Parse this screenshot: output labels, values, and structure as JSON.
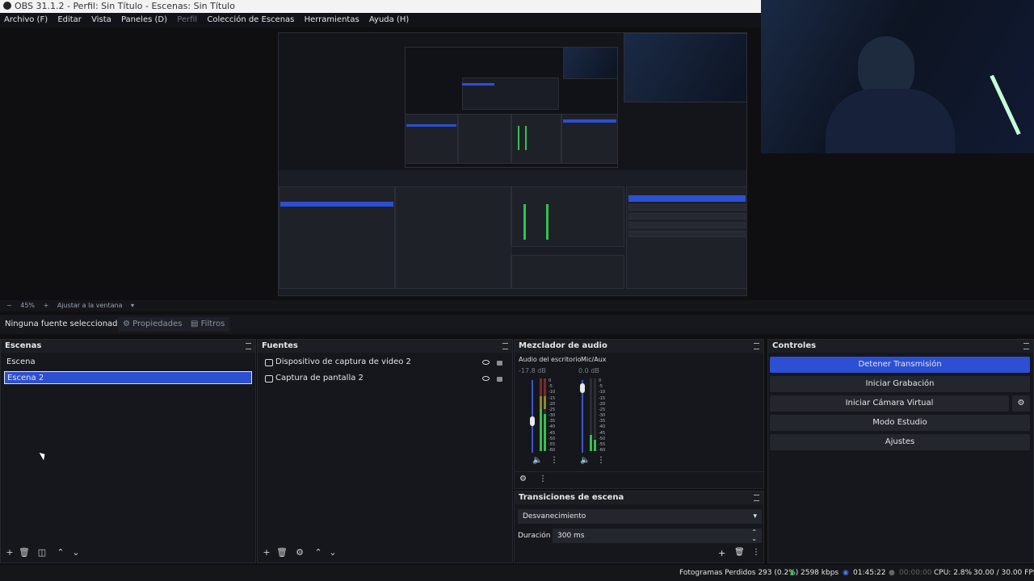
{
  "window": {
    "title": "OBS 31.1.2 - Perfil: Sin Título - Escenas: Sin Título"
  },
  "menu": {
    "items": [
      "Archivo (F)",
      "Editar",
      "Vista",
      "Paneles (D)",
      "Perfil",
      "Colección de Escenas",
      "Herramientas",
      "Ayuda (H)"
    ]
  },
  "zoom": {
    "minus": "−",
    "value": "45%",
    "plus": "+",
    "fit_label": "Ajustar a la ventana"
  },
  "context": {
    "no_source": "Ninguna fuente seleccionad",
    "properties": "Propiedades",
    "filters": "Filtros"
  },
  "scenes": {
    "title": "Escenas",
    "items": [
      "Escena",
      "Escena 2"
    ],
    "selected_index": 1
  },
  "sources": {
    "title": "Fuentes",
    "items": [
      {
        "name": "Dispositivo de captura de video 2",
        "icon": "camera-icon"
      },
      {
        "name": "Captura de pantalla 2",
        "icon": "monitor-icon"
      }
    ]
  },
  "mixer": {
    "title": "Mezclador de audio",
    "channels": [
      {
        "name": "Audio del escritorio",
        "db": "-17.8 dB",
        "level": 0.47
      },
      {
        "name": "Mic/Aux",
        "db": "0.0 dB",
        "level": 0.95
      }
    ],
    "scale": [
      "0",
      "-5",
      "-10",
      "-15",
      "-20",
      "-25",
      "-30",
      "-35",
      "-40",
      "-45",
      "-50",
      "-55",
      "-60"
    ]
  },
  "transitions": {
    "title": "Transiciones de escena",
    "selected": "Desvanecimiento",
    "duration_label": "Duración",
    "duration_value": "300 ms"
  },
  "controls": {
    "title": "Controles",
    "buttons": [
      "Detener Transmisión",
      "Iniciar Grabación",
      "Iniciar Cámara Virtual",
      "Modo Estudio",
      "Ajustes"
    ]
  },
  "status": {
    "dropped": "Fotogramas Perdidos 293 (0.2%)",
    "bitrate": "2598 kbps",
    "stream_time": "01:45:22",
    "rec_time": "00:00:00",
    "cpu": "CPU: 2.8%",
    "fps": "30.00 / 30.00 FPS"
  },
  "colors": {
    "accent": "#2c4fd4",
    "meter_green": "#33c24d",
    "background": "#15171c"
  }
}
